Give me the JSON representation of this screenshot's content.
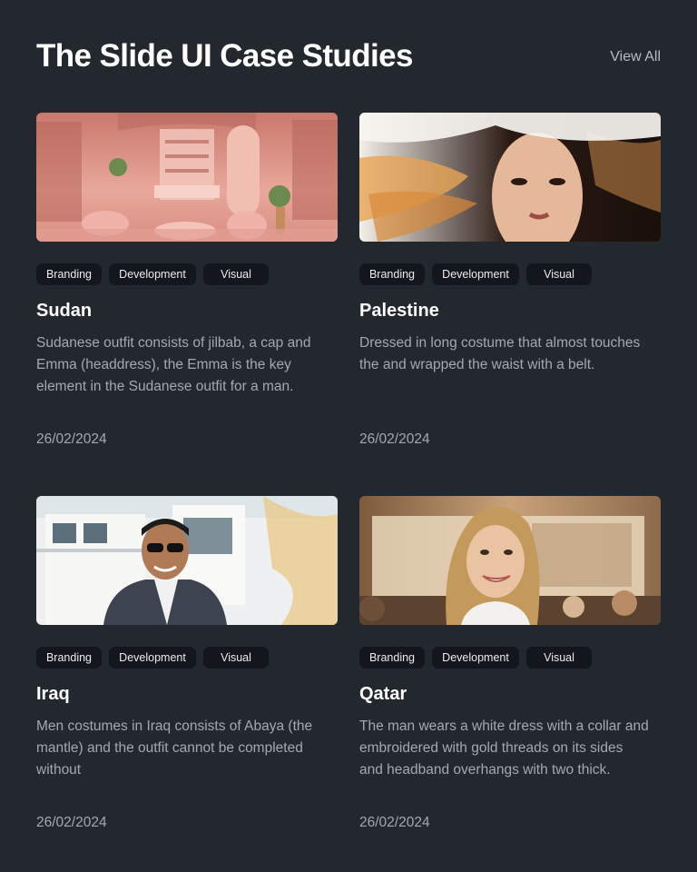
{
  "header": {
    "title": "The Slide UI Case Studies",
    "view_all": "View All"
  },
  "cards": [
    {
      "image": "pink-boutique-interior",
      "tags": [
        "Branding",
        "Development",
        "Visual"
      ],
      "title": "Sudan",
      "description": "Sudanese outfit consists of jilbab, a cap and Emma (headdress), the Emma is the key element in the Sudanese outfit for a man.",
      "date": "26/02/2024"
    },
    {
      "image": "woman-flowing-hair-portrait",
      "tags": [
        "Branding",
        "Development",
        "Visual"
      ],
      "title": "Palestine",
      "description": "Dressed in long costume that almost touches the and wrapped the waist with a belt.",
      "date": "26/02/2024"
    },
    {
      "image": "man-suit-sunglasses-building",
      "tags": [
        "Branding",
        "Development",
        "Visual"
      ],
      "title": "Iraq",
      "description": "Men costumes in Iraq consists of Abaya (the mantle) and the outfit cannot be completed without",
      "date": "26/02/2024"
    },
    {
      "image": "smiling-woman-classroom",
      "tags": [
        "Branding",
        "Development",
        "Visual"
      ],
      "title": "Qatar",
      "description": "The man wears a white dress with a collar and embroidered with gold threads on its sides and headband overhangs with two thick.",
      "date": "26/02/2024"
    }
  ]
}
